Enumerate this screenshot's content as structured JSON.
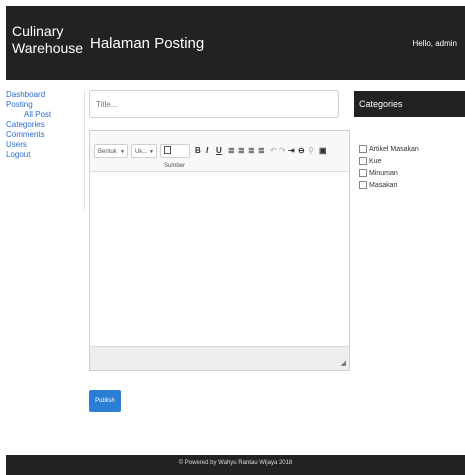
{
  "header": {
    "brand": "Culinary Warehouse",
    "page_title": "Halaman Posting",
    "greeting": "Hello, admin"
  },
  "sidebar": {
    "items": [
      {
        "label": "Dashboard"
      },
      {
        "label": "Posting"
      },
      {
        "label": "All Post"
      },
      {
        "label": "Categories"
      },
      {
        "label": "Comments"
      },
      {
        "label": "Users"
      },
      {
        "label": "Logout"
      }
    ]
  },
  "form": {
    "title_placeholder": "Title...",
    "publish_label": "Publish"
  },
  "editor": {
    "format_dropdown": "Bentuk",
    "size_dropdown": "Uk...",
    "source_label": "Sumber"
  },
  "categories": {
    "header": "Categories",
    "items": [
      {
        "label": "Artikel Masakan",
        "checked": false
      },
      {
        "label": "Kue",
        "checked": false
      },
      {
        "label": "Minuman",
        "checked": false
      },
      {
        "label": "Masakan",
        "checked": false
      }
    ]
  },
  "footer": {
    "text": "© Powered by Wahyu Rantau Wijaya 2018"
  }
}
